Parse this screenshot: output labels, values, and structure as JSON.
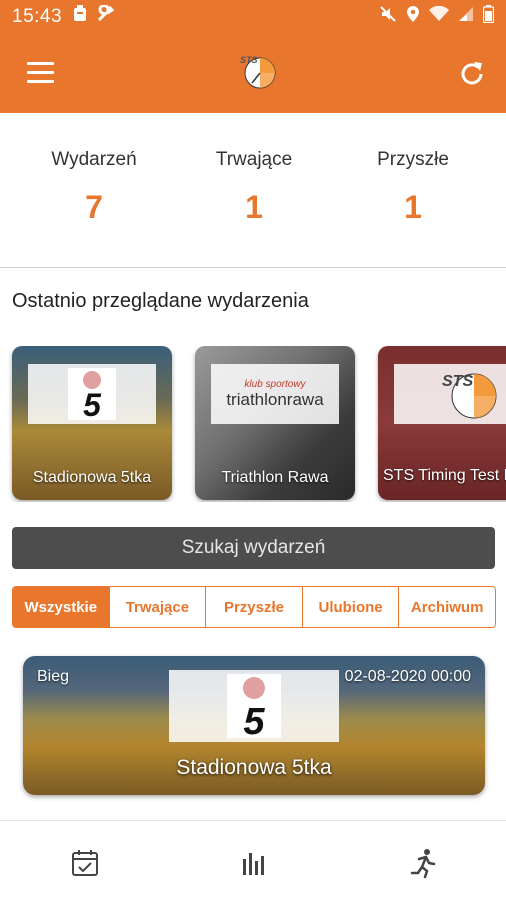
{
  "status_bar": {
    "time": "15:43",
    "icons": [
      "notification-icon",
      "wrench-icon",
      "mute-icon",
      "location-icon",
      "wifi-icon",
      "signal-icon",
      "battery-icon"
    ]
  },
  "app_bar": {
    "menu_icon": "hamburger-menu-icon",
    "logo": "STS",
    "refresh_icon": "refresh-icon"
  },
  "stats": [
    {
      "label": "Wydarzeń",
      "value": "7"
    },
    {
      "label": "Trwające",
      "value": "1"
    },
    {
      "label": "Przyszłe",
      "value": "1"
    }
  ],
  "recent": {
    "title": "Ostatnio przeglądane wydarzenia",
    "cards": [
      {
        "title": "Stadionowa 5tka",
        "logo_text": "5"
      },
      {
        "title": "Triathlon Rawa",
        "logo_text": "triathlonrawa",
        "logo_sub": "klub sportowy"
      },
      {
        "title": "STS Timing Test Run",
        "logo_text": "STS"
      }
    ]
  },
  "search_button": "Szukaj wydarzeń",
  "filter_tabs": [
    "Wszystkie",
    "Trwające",
    "Przyszłe",
    "Ulubione",
    "Archiwum"
  ],
  "active_tab": "Wszystkie",
  "event": {
    "type": "Bieg",
    "date": "02-08-2020 00:00",
    "title": "Stadionowa 5tka",
    "logo_text": "5"
  },
  "bottom_nav": [
    "calendar-check-icon",
    "stats-bars-icon",
    "runner-icon"
  ],
  "colors": {
    "accent": "#e8762d",
    "search_bg": "#4d4d4d"
  }
}
